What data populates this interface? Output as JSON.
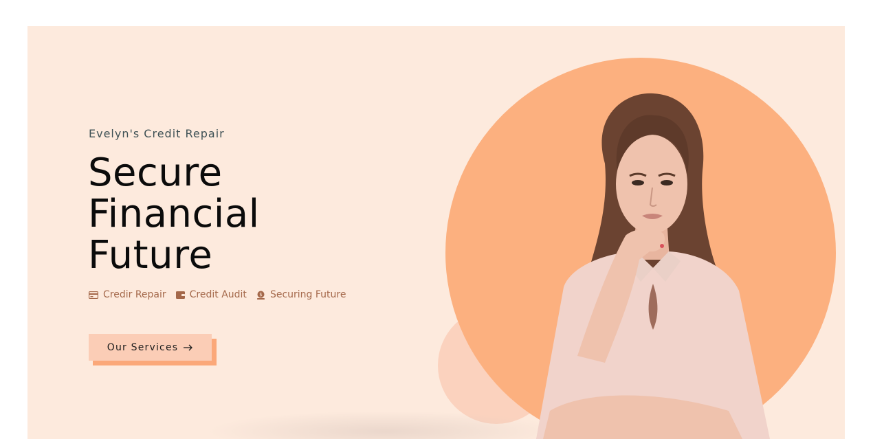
{
  "hero": {
    "kicker": "Evelyn's Credit Repair",
    "headline_lines": [
      "Secure",
      "Financial",
      "Future"
    ],
    "features": [
      {
        "label": "Credir Repair",
        "icon": "credit-card-icon"
      },
      {
        "label": "Credit Audit",
        "icon": "wallet-icon"
      },
      {
        "label": "Securing Future",
        "icon": "piggy-coin-icon"
      }
    ],
    "cta_label": "Our Services",
    "cta_icon": "arrow-right-icon"
  },
  "colors": {
    "background": "#fdeadd",
    "accent_circle": "#fcb07f",
    "soft_circle": "#fbd2be",
    "button": "#fbcdb6",
    "button_shadow": "#fba879",
    "feature_text": "#a4684a",
    "kicker_text": "#3e5155"
  },
  "illustration": {
    "subject": "woman-portrait"
  }
}
